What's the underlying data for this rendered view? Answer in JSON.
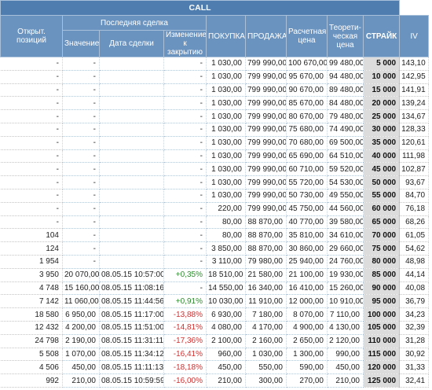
{
  "header": {
    "call": "CALL",
    "open_positions": "Открыт. позиций",
    "last_trade": "Последняя сделка",
    "value": "Значение",
    "trade_date": "Дата сделки",
    "change_close": "Изменение к закрытию",
    "buy": "ПОКУПКА",
    "sell": "ПРОДАЖА",
    "calc_price": "Расчетная цена",
    "theor_price": "Теорети-ческая цена",
    "strike": "СТРАЙК",
    "iv": "IV"
  },
  "rows": [
    {
      "open": "-",
      "value": "-",
      "date": "",
      "change": "-",
      "buy": "1 030,00",
      "sell": "799 990,00",
      "calc": "100 670,00",
      "theor": "99 480,00",
      "strike": "5 000",
      "iv": "143,10",
      "dir": ""
    },
    {
      "open": "-",
      "value": "-",
      "date": "",
      "change": "-",
      "buy": "1 030,00",
      "sell": "799 990,00",
      "calc": "95 670,00",
      "theor": "94 480,00",
      "strike": "10 000",
      "iv": "142,95",
      "dir": ""
    },
    {
      "open": "-",
      "value": "-",
      "date": "",
      "change": "-",
      "buy": "1 030,00",
      "sell": "799 990,00",
      "calc": "90 670,00",
      "theor": "89 480,00",
      "strike": "15 000",
      "iv": "141,91",
      "dir": ""
    },
    {
      "open": "-",
      "value": "-",
      "date": "",
      "change": "-",
      "buy": "1 030,00",
      "sell": "799 990,00",
      "calc": "85 670,00",
      "theor": "84 480,00",
      "strike": "20 000",
      "iv": "139,24",
      "dir": ""
    },
    {
      "open": "-",
      "value": "-",
      "date": "",
      "change": "-",
      "buy": "1 030,00",
      "sell": "799 990,00",
      "calc": "80 670,00",
      "theor": "79 480,00",
      "strike": "25 000",
      "iv": "134,67",
      "dir": ""
    },
    {
      "open": "-",
      "value": "-",
      "date": "",
      "change": "-",
      "buy": "1 030,00",
      "sell": "799 990,00",
      "calc": "75 680,00",
      "theor": "74 490,00",
      "strike": "30 000",
      "iv": "128,33",
      "dir": ""
    },
    {
      "open": "-",
      "value": "-",
      "date": "",
      "change": "-",
      "buy": "1 030,00",
      "sell": "799 990,00",
      "calc": "70 680,00",
      "theor": "69 500,00",
      "strike": "35 000",
      "iv": "120,61",
      "dir": ""
    },
    {
      "open": "-",
      "value": "-",
      "date": "",
      "change": "-",
      "buy": "1 030,00",
      "sell": "799 990,00",
      "calc": "65 690,00",
      "theor": "64 510,00",
      "strike": "40 000",
      "iv": "111,98",
      "dir": ""
    },
    {
      "open": "-",
      "value": "-",
      "date": "",
      "change": "-",
      "buy": "1 030,00",
      "sell": "799 990,00",
      "calc": "60 710,00",
      "theor": "59 520,00",
      "strike": "45 000",
      "iv": "102,87",
      "dir": ""
    },
    {
      "open": "-",
      "value": "-",
      "date": "",
      "change": "-",
      "buy": "1 030,00",
      "sell": "799 990,00",
      "calc": "55 720,00",
      "theor": "54 530,00",
      "strike": "50 000",
      "iv": "93,67",
      "dir": ""
    },
    {
      "open": "-",
      "value": "-",
      "date": "",
      "change": "-",
      "buy": "1 030,00",
      "sell": "799 990,00",
      "calc": "50 730,00",
      "theor": "49 550,00",
      "strike": "55 000",
      "iv": "84,70",
      "dir": ""
    },
    {
      "open": "-",
      "value": "-",
      "date": "",
      "change": "-",
      "buy": "220,00",
      "sell": "799 990,00",
      "calc": "45 750,00",
      "theor": "44 560,00",
      "strike": "60 000",
      "iv": "76,18",
      "dir": ""
    },
    {
      "open": "-",
      "value": "-",
      "date": "",
      "change": "-",
      "buy": "80,00",
      "sell": "88 870,00",
      "calc": "40 770,00",
      "theor": "39 580,00",
      "strike": "65 000",
      "iv": "68,26",
      "dir": ""
    },
    {
      "open": "104",
      "value": "-",
      "date": "",
      "change": "-",
      "buy": "80,00",
      "sell": "88 870,00",
      "calc": "35 810,00",
      "theor": "34 610,00",
      "strike": "70 000",
      "iv": "61,05",
      "dir": ""
    },
    {
      "open": "124",
      "value": "-",
      "date": "",
      "change": "-",
      "buy": "3 850,00",
      "sell": "88 870,00",
      "calc": "30 860,00",
      "theor": "29 660,00",
      "strike": "75 000",
      "iv": "54,62",
      "dir": ""
    },
    {
      "open": "1 954",
      "value": "-",
      "date": "",
      "change": "-",
      "buy": "3 110,00",
      "sell": "79 980,00",
      "calc": "25 940,00",
      "theor": "24 760,00",
      "strike": "80 000",
      "iv": "48,98",
      "dir": ""
    },
    {
      "open": "3 950",
      "value": "20 070,00",
      "date": "08.05.15 10:57:00",
      "change": "+0,35%",
      "buy": "18 510,00",
      "sell": "21 580,00",
      "calc": "21 100,00",
      "theor": "19 930,00",
      "strike": "85 000",
      "iv": "44,14",
      "dir": "pos"
    },
    {
      "open": "4 748",
      "value": "15 160,00",
      "date": "08.05.15 11:08:16",
      "change": "-",
      "buy": "14 550,00",
      "sell": "16 340,00",
      "calc": "16 410,00",
      "theor": "15 260,00",
      "strike": "90 000",
      "iv": "40,08",
      "dir": ""
    },
    {
      "open": "7 142",
      "value": "11 060,00",
      "date": "08.05.15 11:44:56",
      "change": "+0,91%",
      "buy": "10 030,00",
      "sell": "11 910,00",
      "calc": "12 000,00",
      "theor": "10 910,00",
      "strike": "95 000",
      "iv": "36,79",
      "dir": "pos"
    },
    {
      "open": "18 580",
      "value": "6 950,00",
      "date": "08.05.15 11:17:00",
      "change": "-13,88%",
      "buy": "6 930,00",
      "sell": "7 180,00",
      "calc": "8 070,00",
      "theor": "7 110,00",
      "strike": "100 000",
      "iv": "34,23",
      "dir": "neg"
    },
    {
      "open": "12 432",
      "value": "4 200,00",
      "date": "08.05.15 11:51:00",
      "change": "-14,81%",
      "buy": "4 080,00",
      "sell": "4 170,00",
      "calc": "4 900,00",
      "theor": "4 130,00",
      "strike": "105 000",
      "iv": "32,39",
      "dir": "neg"
    },
    {
      "open": "24 798",
      "value": "2 190,00",
      "date": "08.05.15 11:31:11",
      "change": "-17,36%",
      "buy": "2 100,00",
      "sell": "2 160,00",
      "calc": "2 650,00",
      "theor": "2 120,00",
      "strike": "110 000",
      "iv": "31,28",
      "dir": "neg"
    },
    {
      "open": "5 508",
      "value": "1 070,00",
      "date": "08.05.15 11:34:12",
      "change": "-16,41%",
      "buy": "960,00",
      "sell": "1 030,00",
      "calc": "1 300,00",
      "theor": "990,00",
      "strike": "115 000",
      "iv": "30,92",
      "dir": "neg"
    },
    {
      "open": "4 506",
      "value": "450,00",
      "date": "08.05.15 11:11:13",
      "change": "-18,18%",
      "buy": "450,00",
      "sell": "550,00",
      "calc": "590,00",
      "theor": "450,00",
      "strike": "120 000",
      "iv": "31,33",
      "dir": "neg"
    },
    {
      "open": "992",
      "value": "210,00",
      "date": "08.05.15 10:59:59",
      "change": "-16,00%",
      "buy": "210,00",
      "sell": "300,00",
      "calc": "270,00",
      "theor": "210,00",
      "strike": "125 000",
      "iv": "32,41",
      "dir": "neg"
    }
  ]
}
